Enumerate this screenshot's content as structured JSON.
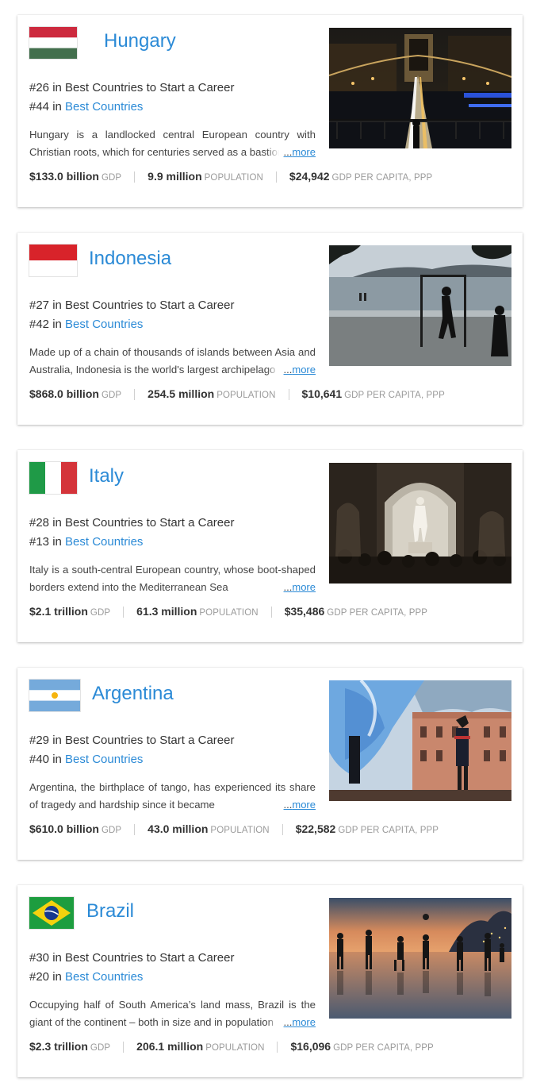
{
  "cards": [
    {
      "country": "Hungary",
      "rank_career": "#26 in Best Countries to Start a Career",
      "rank_best_prefix": "#44 in ",
      "rank_best_link": "Best Countries",
      "description": "Hungary is a landlocked central European country with Christian roots, which for centuries served as a bastion",
      "more_dots": "...",
      "more_label": "more",
      "gdp_value": "$133.0 billion",
      "gdp_label": "GDP",
      "population_value": "9.9 million",
      "population_label": "POPULATION",
      "per_capita_value": "$24,942",
      "per_capita_label": "GDP PER CAPITA, PPP",
      "flag_icon": "flag-hungary",
      "photo_icon": "photo-chain-bridge-night"
    },
    {
      "country": "Indonesia",
      "rank_career": "#27 in Best Countries to Start a Career",
      "rank_best_prefix": "#42 in ",
      "rank_best_link": "Best Countries",
      "description": "Made up of a chain of thousands of islands between Asia and Australia, Indonesia is the world's largest archipelago",
      "more_dots": "...",
      "more_label": "more",
      "gdp_value": "$868.0 billion",
      "gdp_label": "GDP",
      "population_value": "254.5 million",
      "population_label": "POPULATION",
      "per_capita_value": "$10,641",
      "per_capita_label": "GDP PER CAPITA, PPP",
      "flag_icon": "flag-indonesia",
      "photo_icon": "photo-beach-silhouettes"
    },
    {
      "country": "Italy",
      "rank_career": "#28 in Best Countries to Start a Career",
      "rank_best_prefix": "#13 in ",
      "rank_best_link": "Best Countries",
      "description": "Italy is a south-central European country, whose boot-shaped borders extend into the Mediterranean Sea",
      "more_dots": "...",
      "more_label": "more",
      "gdp_value": "$2.1 trillion",
      "gdp_label": "GDP",
      "population_value": "61.3 million",
      "population_label": "POPULATION",
      "per_capita_value": "$35,486",
      "per_capita_label": "GDP PER CAPITA, PPP",
      "flag_icon": "flag-italy",
      "photo_icon": "photo-statue-gallery"
    },
    {
      "country": "Argentina",
      "rank_career": "#29 in Best Countries to Start a Career",
      "rank_best_prefix": "#40 in ",
      "rank_best_link": "Best Countries",
      "description": "Argentina, the birthplace of tango, has experienced its share of tragedy and hardship since it became",
      "more_dots": "...",
      "more_label": "more",
      "gdp_value": "$610.0 billion",
      "gdp_label": "GDP",
      "population_value": "43.0 million",
      "population_label": "POPULATION",
      "per_capita_value": "$22,582",
      "per_capita_label": "GDP PER CAPITA, PPP",
      "flag_icon": "flag-argentina",
      "photo_icon": "photo-flag-casa-rosada"
    },
    {
      "country": "Brazil",
      "rank_career": "#30 in Best Countries to Start a Career",
      "rank_best_prefix": "#20 in ",
      "rank_best_link": "Best Countries",
      "description": "Occupying half of South America’s land mass, Brazil is the giant of the continent – both in size and in population",
      "more_dots": "...",
      "more_label": "more",
      "gdp_value": "$2.3 trillion",
      "gdp_label": "GDP",
      "population_value": "206.1 million",
      "population_label": "POPULATION",
      "per_capita_value": "$16,096",
      "per_capita_label": "GDP PER CAPITA, PPP",
      "flag_icon": "flag-brazil",
      "photo_icon": "photo-beach-football"
    }
  ]
}
